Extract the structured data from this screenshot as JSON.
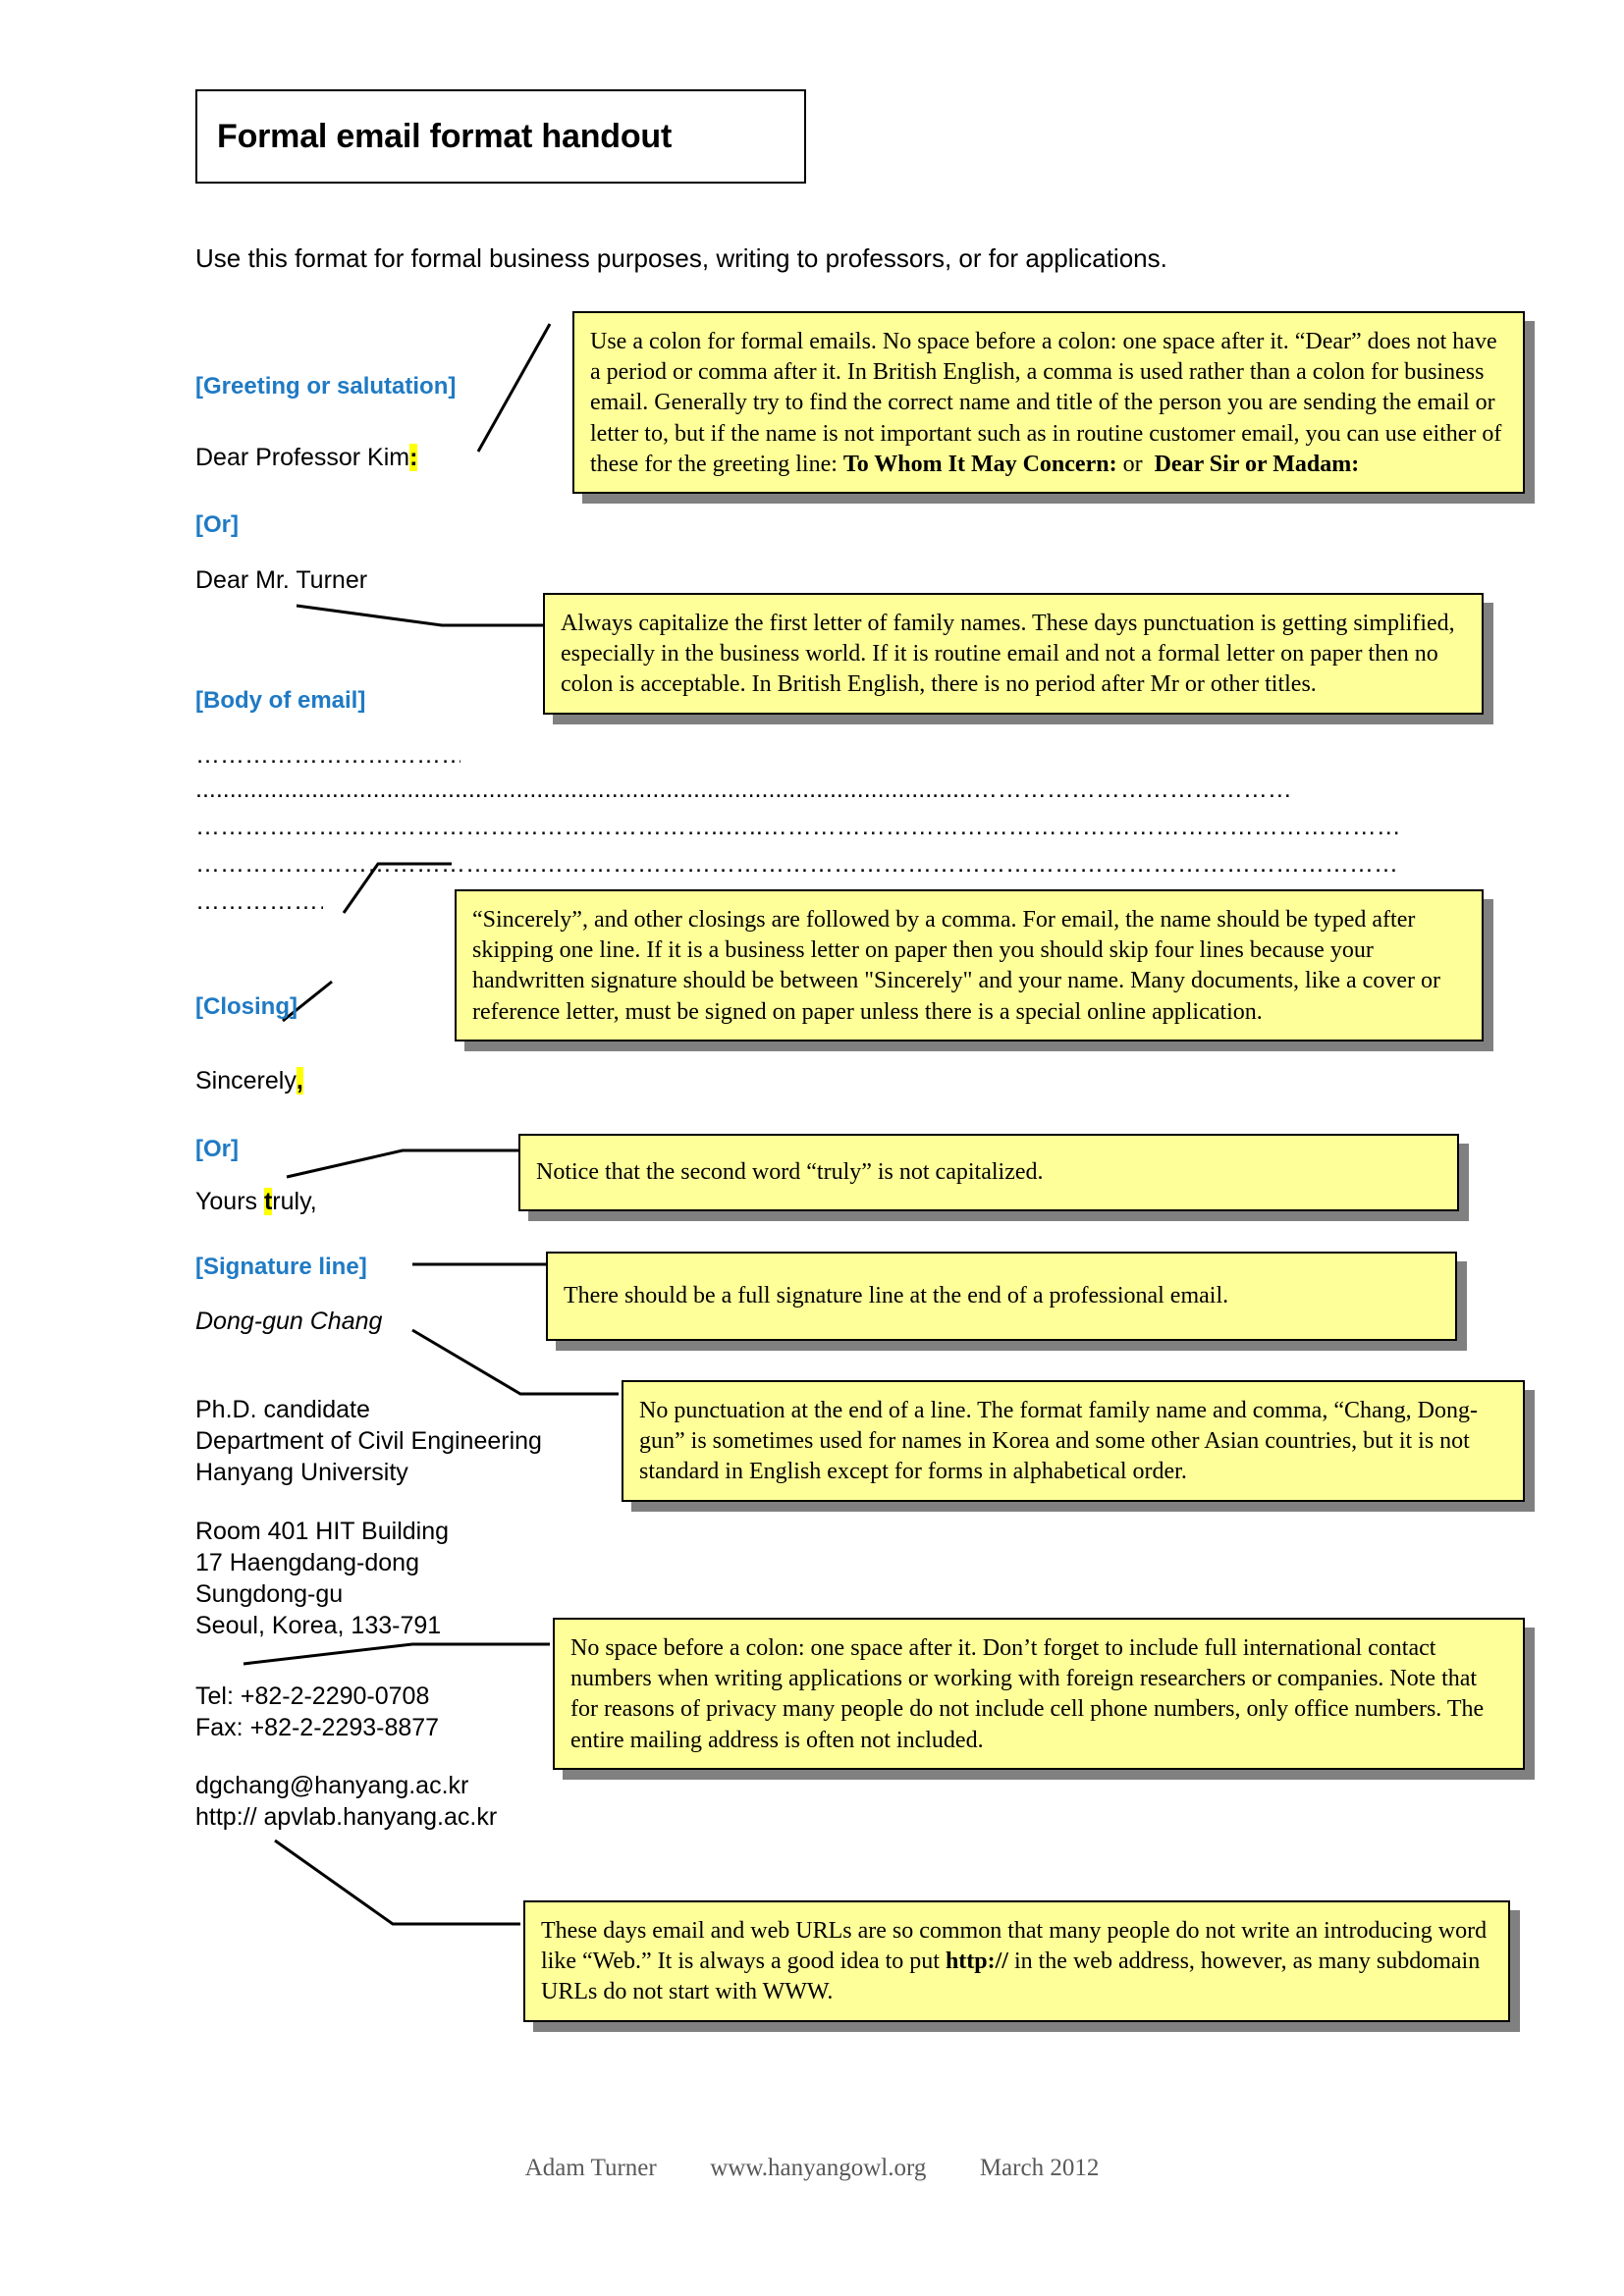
{
  "document": {
    "title": "Formal email format handout",
    "intro": "Use this format for formal business purposes, writing to professors, or for applications."
  },
  "labels": {
    "greeting": "[Greeting or salutation]",
    "or_1": "[Or]",
    "body": "[Body of email]",
    "closing": "[Closing]",
    "or_2": "[Or]",
    "signature": "[Signature line]"
  },
  "email_sample": {
    "greeting_line_text": "Dear Professor Kim",
    "greeting_line_highlight": ":",
    "greeting_alt": "Dear Mr. Turner",
    "body_lines": [
      "………………………………",
      "..................................................................................................................…………………………………",
      "………………………………………………………..…..……………………………………………………………………",
      "…………………………………………………………………………………………………………………………………",
      "………………"
    ],
    "closing_text": "Sincerely",
    "closing_highlight": ",",
    "closing_alt_prefix": "Yours ",
    "closing_alt_highlight": "t",
    "closing_alt_suffix": "ruly,",
    "signature_name": "Dong-gun Chang",
    "affiliation": [
      "Ph.D. candidate",
      "Department of Civil Engineering",
      "Hanyang University"
    ],
    "address": [
      "Room 401 HIT Building",
      "17 Haengdang-dong",
      "Sungdong-gu",
      "Seoul, Korea, 133-791"
    ],
    "contact": [
      "Tel: +82-2-2290-0708",
      "Fax: +82-2-2293-8877"
    ],
    "web": [
      "dgchang@hanyang.ac.kr",
      "http:// apvlab.hanyang.ac.kr"
    ]
  },
  "callouts": {
    "greeting_note": {
      "body": "Use a colon for formal emails. No space before a colon: one space after it. “Dear” does not have a period or comma after it. In British English, a comma is used rather than a colon for business email. Generally try to find the correct name and title of the person you are sending the email or letter to, but if the name is not important such as in routine customer email, you can use either of these for the greeting line:",
      "bold_1": "To Whom It May Concern:",
      "mid": "or",
      "bold_2": "Dear Sir or Madam:"
    },
    "family_name_note": "Always capitalize the first letter of family names. These days punctuation is getting simplified, especially in the business world. If it is routine email and not a formal letter on paper then no colon is acceptable. In British English, there is no period after Mr or other titles.",
    "closing_note": "“Sincerely”, and other closings are followed by a comma. For email, the name should be typed after skipping one line. If it is a business letter on paper then you should skip four lines because your handwritten signature should be between \"Sincerely\" and your name. Many documents, like a cover or reference letter, must be signed on paper unless there is a special online application.",
    "truly_note": "Notice that the second word “truly” is not capitalized.",
    "signature_note": "There should be a full signature line at the end of a professional email.",
    "name_format_note": "No punctuation at the end of a line. The format family name and comma, “Chang, Dong-gun” is sometimes used for names in Korea and some other Asian countries, but it is not standard in English except for forms in alphabetical order.",
    "contact_note": "No space before a colon: one space after it. Don’t forget to include full international contact numbers when writing applications or working with foreign researchers or companies. Note that for reasons of privacy many people do not include cell phone numbers, only office numbers. The entire mailing address is often not included.",
    "url_note_part1": "These days email and web URLs are so common that many people do not write an introducing word like “Web.” It is always a good idea to put ",
    "url_note_bold": "http://",
    "url_note_part2": " in the web address, however, as many subdomain URLs do not start with WWW."
  },
  "footer": {
    "author": "Adam Turner",
    "website": "www.hanyangowl.org",
    "date": "March 2012"
  },
  "colors": {
    "label_blue": "#1F7AC4",
    "callout_yellow": "#FFFF99",
    "highlight_yellow": "#FFFF00",
    "shadow_gray": "#808080",
    "footer_gray": "#595959"
  }
}
